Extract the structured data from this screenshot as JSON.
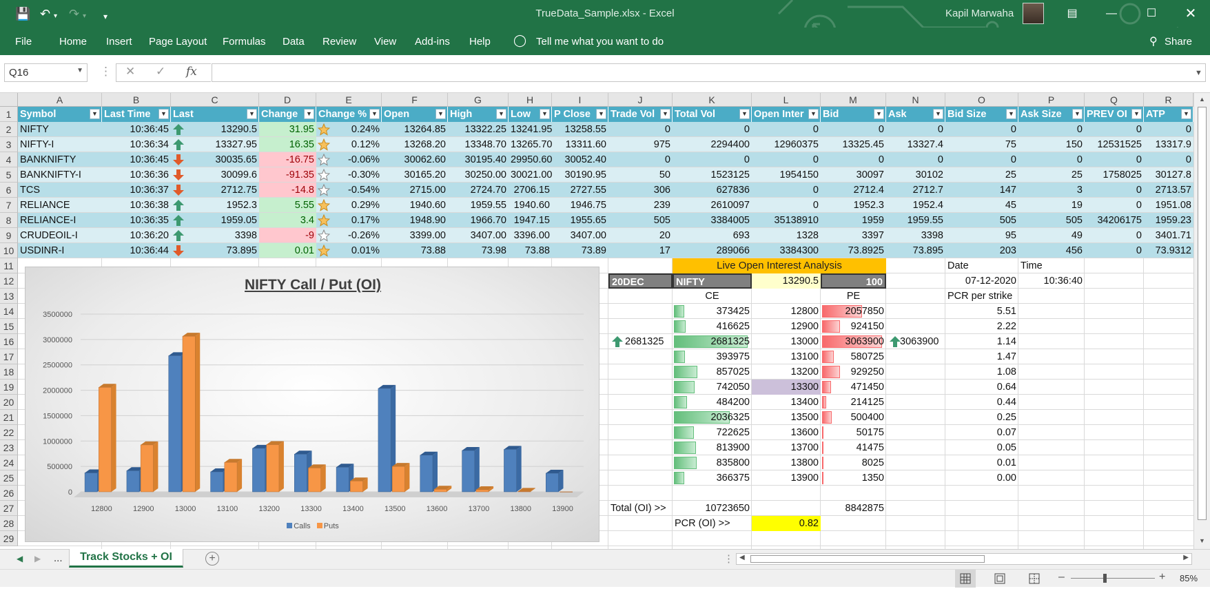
{
  "titlebar": {
    "doc_title": "TrueData_Sample.xlsx  -  Excel",
    "user": "Kapil Marwaha",
    "quick_access": [
      "save-icon",
      "undo-icon",
      "redo-icon",
      "customize-icon"
    ]
  },
  "ribbon": {
    "tabs": [
      "File",
      "Home",
      "Insert",
      "Page Layout",
      "Formulas",
      "Data",
      "Review",
      "View",
      "Add-ins",
      "Help"
    ],
    "tell_me": "Tell me what you want to do",
    "share": "Share"
  },
  "formula_bar": {
    "name_box": "Q16",
    "fx": "fx",
    "value": ""
  },
  "columns": [
    "A",
    "B",
    "C",
    "D",
    "E",
    "F",
    "G",
    "H",
    "I",
    "J",
    "K",
    "L",
    "M",
    "N",
    "O",
    "P",
    "Q",
    "R"
  ],
  "rows": [
    "1",
    "2",
    "3",
    "4",
    "5",
    "6",
    "7",
    "8",
    "9",
    "10",
    "11",
    "12",
    "13",
    "14",
    "15",
    "16",
    "17",
    "18",
    "19",
    "20",
    "21",
    "22",
    "23",
    "24",
    "25",
    "26",
    "27",
    "28",
    "29"
  ],
  "table": {
    "headers": [
      "Symbol",
      "Last Time",
      "Last",
      "Change",
      "Change %",
      "Open",
      "High",
      "Low",
      "P Close",
      "Trade Vol",
      "Total Vol",
      "Open Inter",
      "Bid",
      "Ask",
      "Bid Size",
      "Ask Size",
      "PREV OI",
      "ATP"
    ],
    "rows": [
      {
        "symbol": "NIFTY",
        "time": "10:36:45",
        "dir": "up",
        "last": "13290.5",
        "change": "31.95",
        "sign": "pos",
        "star": "full",
        "pct": "0.24%",
        "open": "13264.85",
        "high": "13322.25",
        "low": "13241.95",
        "pclose": "13258.55",
        "tvol": "0",
        "totvol": "0",
        "oi": "0",
        "bid": "0",
        "ask": "0",
        "bidsize": "0",
        "asksize": "0",
        "prevoi": "0",
        "atp": "0"
      },
      {
        "symbol": "NIFTY-I",
        "time": "10:36:34",
        "dir": "up",
        "last": "13327.95",
        "change": "16.35",
        "sign": "pos",
        "star": "full",
        "pct": "0.12%",
        "open": "13268.20",
        "high": "13348.70",
        "low": "13265.70",
        "pclose": "13311.60",
        "tvol": "975",
        "totvol": "2294400",
        "oi": "12960375",
        "bid": "13325.45",
        "ask": "13327.4",
        "bidsize": "75",
        "asksize": "150",
        "prevoi": "12531525",
        "atp": "13317.9"
      },
      {
        "symbol": "BANKNIFTY",
        "time": "10:36:45",
        "dir": "down",
        "last": "30035.65",
        "change": "-16.75",
        "sign": "neg",
        "star": "empty",
        "pct": "-0.06%",
        "open": "30062.60",
        "high": "30195.40",
        "low": "29950.60",
        "pclose": "30052.40",
        "tvol": "0",
        "totvol": "0",
        "oi": "0",
        "bid": "0",
        "ask": "0",
        "bidsize": "0",
        "asksize": "0",
        "prevoi": "0",
        "atp": "0"
      },
      {
        "symbol": "BANKNIFTY-I",
        "time": "10:36:36",
        "dir": "down",
        "last": "30099.6",
        "change": "-91.35",
        "sign": "neg",
        "star": "empty",
        "pct": "-0.30%",
        "open": "30165.20",
        "high": "30250.00",
        "low": "30021.00",
        "pclose": "30190.95",
        "tvol": "50",
        "totvol": "1523125",
        "oi": "1954150",
        "bid": "30097",
        "ask": "30102",
        "bidsize": "25",
        "asksize": "25",
        "prevoi": "1758025",
        "atp": "30127.8"
      },
      {
        "symbol": "TCS",
        "time": "10:36:37",
        "dir": "down",
        "last": "2712.75",
        "change": "-14.8",
        "sign": "neg",
        "star": "empty",
        "pct": "-0.54%",
        "open": "2715.00",
        "high": "2724.70",
        "low": "2706.15",
        "pclose": "2727.55",
        "tvol": "306",
        "totvol": "627836",
        "oi": "0",
        "bid": "2712.4",
        "ask": "2712.7",
        "bidsize": "147",
        "asksize": "3",
        "prevoi": "0",
        "atp": "2713.57"
      },
      {
        "symbol": "RELIANCE",
        "time": "10:36:38",
        "dir": "up",
        "last": "1952.3",
        "change": "5.55",
        "sign": "pos",
        "star": "full",
        "pct": "0.29%",
        "open": "1940.60",
        "high": "1959.55",
        "low": "1940.60",
        "pclose": "1946.75",
        "tvol": "239",
        "totvol": "2610097",
        "oi": "0",
        "bid": "1952.3",
        "ask": "1952.4",
        "bidsize": "45",
        "asksize": "19",
        "prevoi": "0",
        "atp": "1951.08"
      },
      {
        "symbol": "RELIANCE-I",
        "time": "10:36:35",
        "dir": "up",
        "last": "1959.05",
        "change": "3.4",
        "sign": "pos",
        "star": "full",
        "pct": "0.17%",
        "open": "1948.90",
        "high": "1966.70",
        "low": "1947.15",
        "pclose": "1955.65",
        "tvol": "505",
        "totvol": "3384005",
        "oi": "35138910",
        "bid": "1959",
        "ask": "1959.55",
        "bidsize": "505",
        "asksize": "505",
        "prevoi": "34206175",
        "atp": "1959.23"
      },
      {
        "symbol": "CRUDEOIL-I",
        "time": "10:36:20",
        "dir": "up",
        "last": "3398",
        "change": "-9",
        "sign": "neg",
        "star": "empty",
        "pct": "-0.26%",
        "open": "3399.00",
        "high": "3407.00",
        "low": "3396.00",
        "pclose": "3407.00",
        "tvol": "20",
        "totvol": "693",
        "oi": "1328",
        "bid": "3397",
        "ask": "3398",
        "bidsize": "95",
        "asksize": "49",
        "prevoi": "0",
        "atp": "3401.71"
      },
      {
        "symbol": "USDINR-I",
        "time": "10:36:44",
        "dir": "down",
        "last": "73.895",
        "change": "0.01",
        "sign": "pos",
        "star": "full",
        "pct": "0.01%",
        "open": "73.88",
        "high": "73.98",
        "low": "73.88",
        "pclose": "73.89",
        "tvol": "17",
        "totvol": "289066",
        "oi": "3384300",
        "bid": "73.8925",
        "ask": "73.895",
        "bidsize": "203",
        "asksize": "456",
        "prevoi": "0",
        "atp": "73.9312"
      }
    ]
  },
  "oi": {
    "title": "Live Open Interest Analysis",
    "expiry": "20DEC",
    "symbol": "NIFTY",
    "spot": "13290.5",
    "step": "100",
    "date_label": "Date",
    "date": "07-12-2020",
    "time_label": "Time",
    "time": "10:36:40",
    "ce_label": "CE",
    "pe_label": "PE",
    "pcr_label": "PCR per strike",
    "max_ce": "2681325",
    "max_pe": "3063900",
    "strikes": [
      {
        "ce": "373425",
        "strike": "12800",
        "pe": "2057850",
        "pcr": "5.51",
        "ce_f": 0.14,
        "pe_f": 0.67
      },
      {
        "ce": "416625",
        "strike": "12900",
        "pe": "924150",
        "pcr": "2.22",
        "ce_f": 0.16,
        "pe_f": 0.3
      },
      {
        "ce": "2681325",
        "strike": "13000",
        "pe": "3063900",
        "pcr": "1.14",
        "ce_f": 1.0,
        "pe_f": 1.0
      },
      {
        "ce": "393975",
        "strike": "13100",
        "pe": "580725",
        "pcr": "1.47",
        "ce_f": 0.15,
        "pe_f": 0.19
      },
      {
        "ce": "857025",
        "strike": "13200",
        "pe": "929250",
        "pcr": "1.08",
        "ce_f": 0.32,
        "pe_f": 0.3
      },
      {
        "ce": "742050",
        "strike": "13300",
        "pe": "471450",
        "pcr": "0.64",
        "ce_f": 0.28,
        "pe_f": 0.15
      },
      {
        "ce": "484200",
        "strike": "13400",
        "pe": "214125",
        "pcr": "0.44",
        "ce_f": 0.18,
        "pe_f": 0.07
      },
      {
        "ce": "2036325",
        "strike": "13500",
        "pe": "500400",
        "pcr": "0.25",
        "ce_f": 0.76,
        "pe_f": 0.16
      },
      {
        "ce": "722625",
        "strike": "13600",
        "pe": "50175",
        "pcr": "0.07",
        "ce_f": 0.27,
        "pe_f": 0.02
      },
      {
        "ce": "813900",
        "strike": "13700",
        "pe": "41475",
        "pcr": "0.05",
        "ce_f": 0.3,
        "pe_f": 0.01
      },
      {
        "ce": "835800",
        "strike": "13800",
        "pe": "8025",
        "pcr": "0.01",
        "ce_f": 0.31,
        "pe_f": 0.0
      },
      {
        "ce": "366375",
        "strike": "13900",
        "pe": "1350",
        "pcr": "0.00",
        "ce_f": 0.14,
        "pe_f": 0.0
      }
    ],
    "total_label": "Total (OI) >>",
    "total_ce": "10723650",
    "total_pe": "8842875",
    "pcr_total_label": "PCR (OI) >>",
    "pcr_total": "0.82"
  },
  "chart_data": {
    "type": "bar",
    "title": "NIFTY Call / Put (OI)",
    "categories": [
      "12800",
      "12900",
      "13000",
      "13100",
      "13200",
      "13300",
      "13400",
      "13500",
      "13600",
      "13700",
      "13800",
      "13900"
    ],
    "series": [
      {
        "name": "Calls",
        "color": "#4f81bd",
        "values": [
          373425,
          416625,
          2681325,
          393975,
          857025,
          742050,
          484200,
          2036325,
          722625,
          813900,
          835800,
          366375
        ]
      },
      {
        "name": "Puts",
        "color": "#f79646",
        "values": [
          2057850,
          924150,
          3063900,
          580725,
          929250,
          471450,
          214125,
          500400,
          50175,
          41475,
          8025,
          1350
        ]
      }
    ],
    "ylim": [
      0,
      3500000
    ],
    "yticks": [
      "0",
      "500000",
      "1000000",
      "1500000",
      "2000000",
      "2500000",
      "3000000",
      "3500000"
    ],
    "legend": "bottom"
  },
  "sheet_tab": "Track Stocks + OI",
  "tab_more": "...",
  "zoom": "85%"
}
